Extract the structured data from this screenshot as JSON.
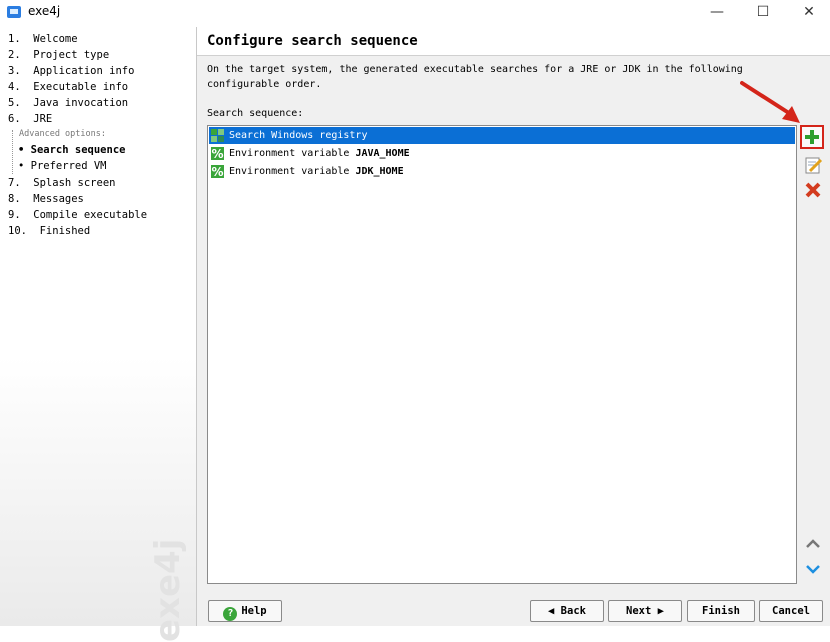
{
  "window": {
    "title": "exe4j",
    "minimize": "—",
    "maximize": "☐",
    "close": "✕"
  },
  "sidebar": {
    "steps": [
      {
        "label": "1.  Welcome"
      },
      {
        "label": "2.  Project type"
      },
      {
        "label": "3.  Application info"
      },
      {
        "label": "4.  Executable info"
      },
      {
        "label": "5.  Java invocation"
      },
      {
        "label": "6.  JRE"
      },
      {
        "label": "Advanced options:"
      },
      {
        "label": "• Search sequence"
      },
      {
        "label": "• Preferred VM"
      },
      {
        "label": "7.  Splash screen"
      },
      {
        "label": "8.  Messages"
      },
      {
        "label": "9.  Compile executable"
      },
      {
        "label": "10.  Finished"
      }
    ],
    "watermark": "exe4j"
  },
  "main": {
    "title": "Configure search sequence",
    "description": "On the target system, the generated executable searches for a JRE or JDK in the following configurable order.",
    "search_label": "Search sequence:",
    "rows": [
      {
        "prefix": "Search Windows registry",
        "bold": "",
        "icon": "registry-icon",
        "selected": true
      },
      {
        "prefix": "Environment variable ",
        "bold": "JAVA_HOME",
        "icon": "percent-icon",
        "selected": false
      },
      {
        "prefix": "Environment variable ",
        "bold": "JDK_HOME",
        "icon": "percent-icon",
        "selected": false
      }
    ]
  },
  "buttons": {
    "help": "Help",
    "back": "Back",
    "next": "Next",
    "finish": "Finish",
    "cancel": "Cancel"
  },
  "colors": {
    "selection": "#0b6fd5",
    "highlight_box": "#d4251a",
    "add_green": "#2e9e2e",
    "remove_red": "#d33c1f"
  }
}
